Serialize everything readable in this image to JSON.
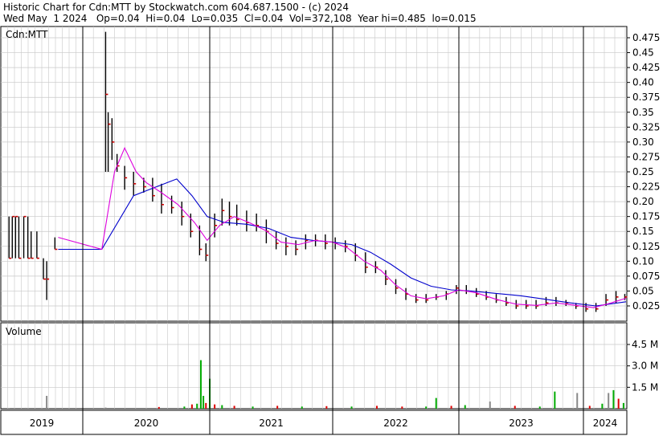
{
  "header": {
    "line1": "Historic Chart for Cdn:MTT by Stockwatch.com 604.687.1500 - (c) 2024",
    "line2": "Wed May  1 2024   Op=0.04  Hi=0.04  Lo=0.035  Cl=0.04  Vol=372,108  Year hi=0.485  lo=0.015"
  },
  "price_panel": {
    "label": "Cdn:MTT"
  },
  "volume_panel": {
    "label": "Volume"
  },
  "colors": {
    "bar": "#000000",
    "close": "#cc0000",
    "ma_short": "#dd00dd",
    "ma_long": "#0000cc",
    "vol_up": "#00aa00",
    "vol_down": "#dd0000",
    "vol_flat": "#888888",
    "grid": "#c8c8c8"
  },
  "chart_data": [
    {
      "type": "bar",
      "title": "Cdn:MTT",
      "ylim": [
        0.0,
        0.5
      ],
      "yticks": [
        "0.475",
        "0.45",
        "0.425",
        "0.40",
        "0.375",
        "0.35",
        "0.325",
        "0.30",
        "0.275",
        "0.25",
        "0.225",
        "0.20",
        "0.175",
        "0.15",
        "0.125",
        "0.10",
        "0.075",
        "0.05",
        "0.025"
      ],
      "x_axis": [
        "2019",
        "2020",
        "2021",
        "2022",
        "2023",
        "2024"
      ],
      "price_bars": [
        {
          "t": 2019.1,
          "h": 0.175,
          "l": 0.105,
          "c": 0.105
        },
        {
          "t": 2019.14,
          "h": 0.175,
          "l": 0.105,
          "c": 0.175
        },
        {
          "t": 2019.18,
          "h": 0.175,
          "l": 0.105,
          "c": 0.175
        },
        {
          "t": 2019.22,
          "h": 0.175,
          "l": 0.105,
          "c": 0.105
        },
        {
          "t": 2019.28,
          "h": 0.175,
          "l": 0.105,
          "c": 0.175
        },
        {
          "t": 2019.33,
          "h": 0.175,
          "l": 0.105,
          "c": 0.105
        },
        {
          "t": 2019.37,
          "h": 0.15,
          "l": 0.105,
          "c": 0.105
        },
        {
          "t": 2019.44,
          "h": 0.15,
          "l": 0.105,
          "c": 0.105
        },
        {
          "t": 2019.52,
          "h": 0.105,
          "l": 0.07,
          "c": 0.07
        },
        {
          "t": 2019.56,
          "h": 0.1,
          "l": 0.035,
          "c": 0.07
        },
        {
          "t": 2019.66,
          "h": 0.14,
          "l": 0.12,
          "c": 0.12
        },
        {
          "t": 2020.18,
          "h": 0.485,
          "l": 0.25,
          "c": 0.38
        },
        {
          "t": 2020.2,
          "h": 0.35,
          "l": 0.25,
          "c": 0.33
        },
        {
          "t": 2020.23,
          "h": 0.34,
          "l": 0.27,
          "c": 0.3
        },
        {
          "t": 2020.27,
          "h": 0.28,
          "l": 0.25,
          "c": 0.26
        },
        {
          "t": 2020.33,
          "h": 0.26,
          "l": 0.22,
          "c": 0.24
        },
        {
          "t": 2020.4,
          "h": 0.25,
          "l": 0.21,
          "c": 0.23
        },
        {
          "t": 2020.48,
          "h": 0.24,
          "l": 0.215,
          "c": 0.225
        },
        {
          "t": 2020.55,
          "h": 0.24,
          "l": 0.2,
          "c": 0.21
        },
        {
          "t": 2020.62,
          "h": 0.23,
          "l": 0.18,
          "c": 0.195
        },
        {
          "t": 2020.7,
          "h": 0.21,
          "l": 0.18,
          "c": 0.19
        },
        {
          "t": 2020.78,
          "h": 0.2,
          "l": 0.16,
          "c": 0.175
        },
        {
          "t": 2020.85,
          "h": 0.18,
          "l": 0.14,
          "c": 0.15
        },
        {
          "t": 2020.92,
          "h": 0.16,
          "l": 0.11,
          "c": 0.12
        },
        {
          "t": 2020.97,
          "h": 0.13,
          "l": 0.1,
          "c": 0.11
        },
        {
          "t": 2021.04,
          "h": 0.18,
          "l": 0.14,
          "c": 0.16
        },
        {
          "t": 2021.1,
          "h": 0.205,
          "l": 0.16,
          "c": 0.185
        },
        {
          "t": 2021.16,
          "h": 0.2,
          "l": 0.16,
          "c": 0.175
        },
        {
          "t": 2021.22,
          "h": 0.195,
          "l": 0.16,
          "c": 0.17
        },
        {
          "t": 2021.3,
          "h": 0.185,
          "l": 0.15,
          "c": 0.165
        },
        {
          "t": 2021.38,
          "h": 0.18,
          "l": 0.15,
          "c": 0.16
        },
        {
          "t": 2021.46,
          "h": 0.17,
          "l": 0.13,
          "c": 0.15
        },
        {
          "t": 2021.54,
          "h": 0.15,
          "l": 0.12,
          "c": 0.13
        },
        {
          "t": 2021.62,
          "h": 0.14,
          "l": 0.11,
          "c": 0.125
        },
        {
          "t": 2021.7,
          "h": 0.135,
          "l": 0.11,
          "c": 0.12
        },
        {
          "t": 2021.78,
          "h": 0.145,
          "l": 0.12,
          "c": 0.135
        },
        {
          "t": 2021.86,
          "h": 0.145,
          "l": 0.125,
          "c": 0.135
        },
        {
          "t": 2021.94,
          "h": 0.145,
          "l": 0.12,
          "c": 0.13
        },
        {
          "t": 2022.02,
          "h": 0.14,
          "l": 0.12,
          "c": 0.13
        },
        {
          "t": 2022.1,
          "h": 0.135,
          "l": 0.115,
          "c": 0.125
        },
        {
          "t": 2022.18,
          "h": 0.13,
          "l": 0.1,
          "c": 0.11
        },
        {
          "t": 2022.26,
          "h": 0.115,
          "l": 0.08,
          "c": 0.09
        },
        {
          "t": 2022.34,
          "h": 0.1,
          "l": 0.08,
          "c": 0.09
        },
        {
          "t": 2022.42,
          "h": 0.085,
          "l": 0.06,
          "c": 0.07
        },
        {
          "t": 2022.5,
          "h": 0.07,
          "l": 0.045,
          "c": 0.055
        },
        {
          "t": 2022.58,
          "h": 0.055,
          "l": 0.035,
          "c": 0.045
        },
        {
          "t": 2022.66,
          "h": 0.045,
          "l": 0.03,
          "c": 0.035
        },
        {
          "t": 2022.74,
          "h": 0.045,
          "l": 0.03,
          "c": 0.035
        },
        {
          "t": 2022.82,
          "h": 0.045,
          "l": 0.035,
          "c": 0.04
        },
        {
          "t": 2022.9,
          "h": 0.05,
          "l": 0.035,
          "c": 0.045
        },
        {
          "t": 2022.98,
          "h": 0.06,
          "l": 0.045,
          "c": 0.055
        },
        {
          "t": 2023.06,
          "h": 0.06,
          "l": 0.045,
          "c": 0.05
        },
        {
          "t": 2023.14,
          "h": 0.055,
          "l": 0.04,
          "c": 0.045
        },
        {
          "t": 2023.22,
          "h": 0.05,
          "l": 0.035,
          "c": 0.04
        },
        {
          "t": 2023.3,
          "h": 0.045,
          "l": 0.03,
          "c": 0.035
        },
        {
          "t": 2023.38,
          "h": 0.04,
          "l": 0.025,
          "c": 0.03
        },
        {
          "t": 2023.46,
          "h": 0.035,
          "l": 0.02,
          "c": 0.025
        },
        {
          "t": 2023.54,
          "h": 0.035,
          "l": 0.02,
          "c": 0.025
        },
        {
          "t": 2023.62,
          "h": 0.035,
          "l": 0.02,
          "c": 0.025
        },
        {
          "t": 2023.7,
          "h": 0.04,
          "l": 0.025,
          "c": 0.03
        },
        {
          "t": 2023.78,
          "h": 0.04,
          "l": 0.025,
          "c": 0.03
        },
        {
          "t": 2023.86,
          "h": 0.035,
          "l": 0.025,
          "c": 0.03
        },
        {
          "t": 2023.94,
          "h": 0.03,
          "l": 0.02,
          "c": 0.025
        },
        {
          "t": 2024.02,
          "h": 0.03,
          "l": 0.015,
          "c": 0.02
        },
        {
          "t": 2024.1,
          "h": 0.03,
          "l": 0.015,
          "c": 0.02
        },
        {
          "t": 2024.18,
          "h": 0.045,
          "l": 0.025,
          "c": 0.035
        },
        {
          "t": 2024.26,
          "h": 0.05,
          "l": 0.03,
          "c": 0.04
        },
        {
          "t": 2024.33,
          "h": 0.045,
          "l": 0.035,
          "c": 0.04
        }
      ],
      "ma_short": [
        {
          "t": 2019.7,
          "v": 0.14
        },
        {
          "t": 2020.15,
          "v": 0.12
        },
        {
          "t": 2020.25,
          "v": 0.25
        },
        {
          "t": 2020.33,
          "v": 0.29
        },
        {
          "t": 2020.42,
          "v": 0.25
        },
        {
          "t": 2020.5,
          "v": 0.232
        },
        {
          "t": 2020.62,
          "v": 0.215
        },
        {
          "t": 2020.75,
          "v": 0.195
        },
        {
          "t": 2020.88,
          "v": 0.165
        },
        {
          "t": 2020.98,
          "v": 0.135
        },
        {
          "t": 2021.08,
          "v": 0.16
        },
        {
          "t": 2021.2,
          "v": 0.175
        },
        {
          "t": 2021.32,
          "v": 0.165
        },
        {
          "t": 2021.45,
          "v": 0.152
        },
        {
          "t": 2021.58,
          "v": 0.132
        },
        {
          "t": 2021.72,
          "v": 0.128
        },
        {
          "t": 2021.86,
          "v": 0.135
        },
        {
          "t": 2022.0,
          "v": 0.132
        },
        {
          "t": 2022.12,
          "v": 0.122
        },
        {
          "t": 2022.25,
          "v": 0.1
        },
        {
          "t": 2022.38,
          "v": 0.085
        },
        {
          "t": 2022.5,
          "v": 0.06
        },
        {
          "t": 2022.62,
          "v": 0.042
        },
        {
          "t": 2022.74,
          "v": 0.037
        },
        {
          "t": 2022.88,
          "v": 0.042
        },
        {
          "t": 2023.0,
          "v": 0.052
        },
        {
          "t": 2023.14,
          "v": 0.047
        },
        {
          "t": 2023.3,
          "v": 0.036
        },
        {
          "t": 2023.46,
          "v": 0.028
        },
        {
          "t": 2023.62,
          "v": 0.026
        },
        {
          "t": 2023.78,
          "v": 0.03
        },
        {
          "t": 2023.94,
          "v": 0.026
        },
        {
          "t": 2024.08,
          "v": 0.022
        },
        {
          "t": 2024.22,
          "v": 0.03
        },
        {
          "t": 2024.34,
          "v": 0.038
        }
      ],
      "ma_long": [
        {
          "t": 2019.7,
          "v": 0.12
        },
        {
          "t": 2020.15,
          "v": 0.12
        },
        {
          "t": 2020.4,
          "v": 0.21
        },
        {
          "t": 2020.58,
          "v": 0.225
        },
        {
          "t": 2020.74,
          "v": 0.238
        },
        {
          "t": 2020.86,
          "v": 0.21
        },
        {
          "t": 2020.98,
          "v": 0.175
        },
        {
          "t": 2021.12,
          "v": 0.165
        },
        {
          "t": 2021.3,
          "v": 0.162
        },
        {
          "t": 2021.48,
          "v": 0.155
        },
        {
          "t": 2021.66,
          "v": 0.14
        },
        {
          "t": 2021.84,
          "v": 0.135
        },
        {
          "t": 2022.0,
          "v": 0.132
        },
        {
          "t": 2022.15,
          "v": 0.128
        },
        {
          "t": 2022.3,
          "v": 0.115
        },
        {
          "t": 2022.46,
          "v": 0.095
        },
        {
          "t": 2022.62,
          "v": 0.072
        },
        {
          "t": 2022.78,
          "v": 0.058
        },
        {
          "t": 2022.94,
          "v": 0.052
        },
        {
          "t": 2023.1,
          "v": 0.05
        },
        {
          "t": 2023.3,
          "v": 0.046
        },
        {
          "t": 2023.5,
          "v": 0.042
        },
        {
          "t": 2023.7,
          "v": 0.036
        },
        {
          "t": 2023.9,
          "v": 0.03
        },
        {
          "t": 2024.1,
          "v": 0.025
        },
        {
          "t": 2024.34,
          "v": 0.032
        }
      ]
    },
    {
      "type": "bar",
      "title": "Volume",
      "ylim": [
        0,
        5200000
      ],
      "yticks": [
        "4.5 M",
        "3.0 M",
        "1.5 M"
      ],
      "volume_bars": [
        {
          "t": 2019.1,
          "v": 50000,
          "d": "flat"
        },
        {
          "t": 2019.3,
          "v": 60000,
          "d": "flat"
        },
        {
          "t": 2019.56,
          "v": 900000,
          "d": "flat"
        },
        {
          "t": 2020.18,
          "v": 80000,
          "d": "flat"
        },
        {
          "t": 2020.6,
          "v": 120000,
          "d": "down"
        },
        {
          "t": 2020.8,
          "v": 150000,
          "d": "up"
        },
        {
          "t": 2020.86,
          "v": 300000,
          "d": "down"
        },
        {
          "t": 2020.9,
          "v": 350000,
          "d": "up"
        },
        {
          "t": 2020.93,
          "v": 3400000,
          "d": "up"
        },
        {
          "t": 2020.95,
          "v": 900000,
          "d": "up"
        },
        {
          "t": 2020.97,
          "v": 400000,
          "d": "down"
        },
        {
          "t": 2021.0,
          "v": 2100000,
          "d": "up"
        },
        {
          "t": 2021.04,
          "v": 300000,
          "d": "down"
        },
        {
          "t": 2021.1,
          "v": 250000,
          "d": "up"
        },
        {
          "t": 2021.2,
          "v": 200000,
          "d": "down"
        },
        {
          "t": 2021.35,
          "v": 150000,
          "d": "up"
        },
        {
          "t": 2021.55,
          "v": 200000,
          "d": "down"
        },
        {
          "t": 2021.75,
          "v": 150000,
          "d": "up"
        },
        {
          "t": 2021.95,
          "v": 180000,
          "d": "down"
        },
        {
          "t": 2022.15,
          "v": 150000,
          "d": "up"
        },
        {
          "t": 2022.35,
          "v": 200000,
          "d": "down"
        },
        {
          "t": 2022.55,
          "v": 150000,
          "d": "down"
        },
        {
          "t": 2022.74,
          "v": 150000,
          "d": "up"
        },
        {
          "t": 2022.82,
          "v": 750000,
          "d": "up"
        },
        {
          "t": 2022.94,
          "v": 200000,
          "d": "down"
        },
        {
          "t": 2023.05,
          "v": 250000,
          "d": "up"
        },
        {
          "t": 2023.25,
          "v": 500000,
          "d": "flat"
        },
        {
          "t": 2023.45,
          "v": 200000,
          "d": "down"
        },
        {
          "t": 2023.65,
          "v": 150000,
          "d": "up"
        },
        {
          "t": 2023.77,
          "v": 1200000,
          "d": "up"
        },
        {
          "t": 2023.95,
          "v": 1100000,
          "d": "flat"
        },
        {
          "t": 2024.05,
          "v": 200000,
          "d": "down"
        },
        {
          "t": 2024.15,
          "v": 350000,
          "d": "up"
        },
        {
          "t": 2024.2,
          "v": 1100000,
          "d": "flat"
        },
        {
          "t": 2024.24,
          "v": 1300000,
          "d": "up"
        },
        {
          "t": 2024.28,
          "v": 700000,
          "d": "down"
        },
        {
          "t": 2024.32,
          "v": 400000,
          "d": "up"
        }
      ]
    }
  ]
}
